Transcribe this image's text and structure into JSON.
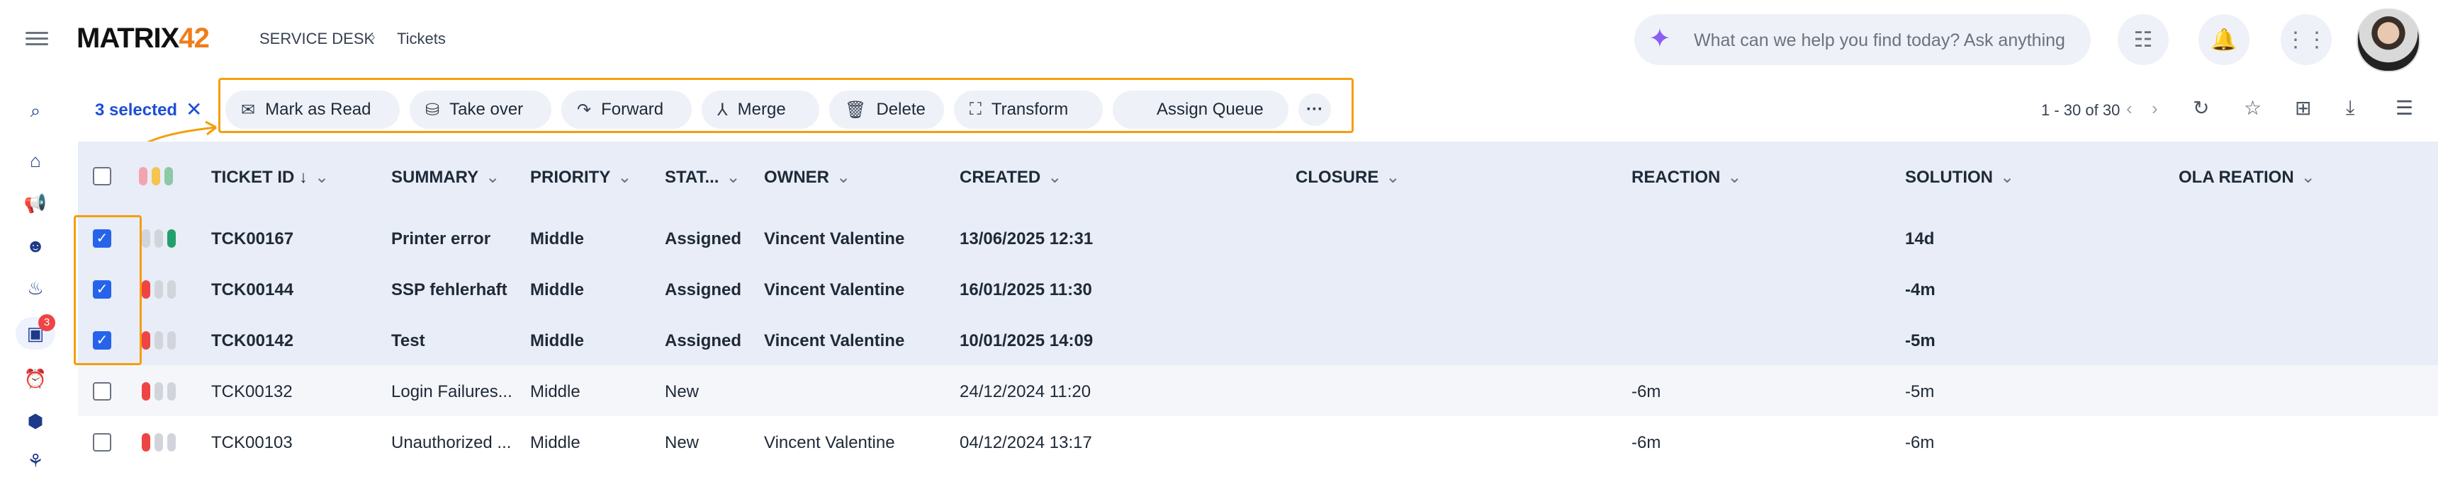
{
  "header": {
    "logo_main": "MATRIX",
    "logo_num": "42",
    "breadcrumb": [
      "SERVICE DESK",
      "Tickets"
    ],
    "search_placeholder": "What can we help you find today? Ask anything",
    "icons": [
      "checklist-icon",
      "bell-icon",
      "apps-grid-icon",
      "user-avatar"
    ]
  },
  "sidebar": {
    "icons": [
      "search-icon",
      "home-icon",
      "megaphone-icon",
      "people-icon",
      "fire-icon",
      "ticket-icon",
      "alarm-icon",
      "alert-icon"
    ],
    "ticket_badge": "3"
  },
  "toolbar": {
    "selected_label": "3 selected",
    "clear_label": "✕",
    "actions": [
      {
        "label": "Mark as Read",
        "icon": "mail-icon"
      },
      {
        "label": "Take over",
        "icon": "take-over-icon"
      },
      {
        "label": "Forward",
        "icon": "forward-icon"
      },
      {
        "label": "Merge",
        "icon": "merge-icon"
      },
      {
        "label": "Delete",
        "icon": "trash-icon"
      },
      {
        "label": "Transform",
        "icon": "transform-icon"
      },
      {
        "label": "Assign Queue",
        "icon": ""
      }
    ],
    "more_label": "···",
    "pager": "1 - 30 of 30"
  },
  "table": {
    "columns": [
      "TICKET ID",
      "SUMMARY",
      "PRIORITY",
      "STAT...",
      "OWNER",
      "CREATED",
      "CLOSURE",
      "REACTION",
      "SOLUTION",
      "OLA REATION"
    ],
    "sort_arrow": "↓",
    "rows": [
      {
        "selected": true,
        "bold": true,
        "prio": [
          "grey",
          "grey",
          "green"
        ],
        "id": "TCK00167",
        "summary": "Printer error",
        "priority": "Middle",
        "status": "Assigned",
        "owner": "Vincent Valentine",
        "created": "13/06/2025 12:31",
        "closure": "",
        "reaction": "",
        "solution": "14d",
        "ola": ""
      },
      {
        "selected": true,
        "bold": true,
        "prio": [
          "red",
          "grey",
          "grey"
        ],
        "id": "TCK00144",
        "summary": "SSP fehlerhaft",
        "priority": "Middle",
        "status": "Assigned",
        "owner": "Vincent Valentine",
        "created": "16/01/2025 11:30",
        "closure": "",
        "reaction": "",
        "solution": "-4m",
        "ola": ""
      },
      {
        "selected": true,
        "bold": true,
        "prio": [
          "red",
          "grey",
          "grey"
        ],
        "id": "TCK00142",
        "summary": "Test",
        "priority": "Middle",
        "status": "Assigned",
        "owner": "Vincent Valentine",
        "created": "10/01/2025 14:09",
        "closure": "",
        "reaction": "",
        "solution": "-5m",
        "ola": ""
      },
      {
        "selected": false,
        "bold": false,
        "prio": [
          "red",
          "grey",
          "grey"
        ],
        "id": "TCK00132",
        "summary": "Login Failures...",
        "priority": "Middle",
        "status": "New",
        "owner": "",
        "created": "24/12/2024 11:20",
        "closure": "",
        "reaction": "-6m",
        "solution": "-5m",
        "ola": ""
      },
      {
        "selected": false,
        "bold": false,
        "prio": [
          "red",
          "grey",
          "grey"
        ],
        "id": "TCK00103",
        "summary": "Unauthorized ...",
        "priority": "Middle",
        "status": "New",
        "owner": "Vincent Valentine",
        "created": "04/12/2024 13:17",
        "closure": "",
        "reaction": "-6m",
        "solution": "-6m",
        "ola": ""
      }
    ]
  },
  "colors": {
    "accent": "#2563eb",
    "highlight": "#f59e0b",
    "prio_red": "#ef4444",
    "prio_green": "#22a06b",
    "prio_grey": "#d1d5db",
    "prio_yellow": "#f5c451",
    "prio_pink": "#f3a4b0"
  }
}
